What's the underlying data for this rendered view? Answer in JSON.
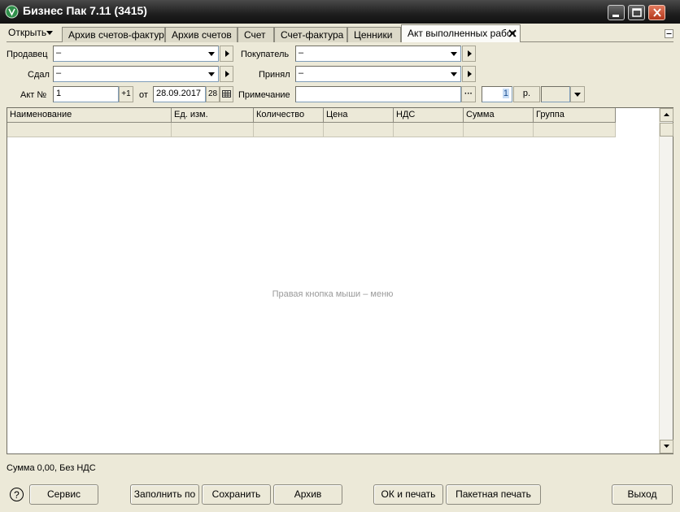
{
  "window": {
    "title": "Бизнес Пак 7.11 (3415)"
  },
  "menu": {
    "open_label": "Открыть"
  },
  "tabs": [
    {
      "label": "Архив счетов-фактур"
    },
    {
      "label": "Архив счетов"
    },
    {
      "label": "Счет"
    },
    {
      "label": "Счет-фактура"
    },
    {
      "label": "Ценники"
    },
    {
      "label": "Акт выполненных работ"
    }
  ],
  "form": {
    "seller_label": "Продавец",
    "seller_value": "–",
    "buyer_label": "Покупатель",
    "buyer_value": "–",
    "handed_label": "Сдал",
    "handed_value": "–",
    "accepted_label": "Принял",
    "accepted_value": "–",
    "act_label": "Акт №",
    "act_number": "1",
    "increment_label": "+1",
    "from_label": "от",
    "date_value": "28.09.2017",
    "date_day_button": "28",
    "note_label": "Примечание",
    "note_value": "",
    "ellipsis_label": "···",
    "amount_value": "1",
    "currency_label": "р."
  },
  "grid": {
    "columns": [
      "Наименование",
      "Ед. изм.",
      "Количество",
      "Цена",
      "НДС",
      "Сумма",
      "Группа"
    ],
    "hint": "Правая кнопка мыши – меню"
  },
  "status": {
    "text": "Сумма 0,00, Без НДС"
  },
  "buttons": {
    "help": "?",
    "service": "Сервис",
    "fill_by": "Заполнить по",
    "save": "Сохранить",
    "archive": "Архив",
    "ok_print": "ОК и печать",
    "batch_print": "Пакетная печать",
    "exit": "Выход"
  }
}
